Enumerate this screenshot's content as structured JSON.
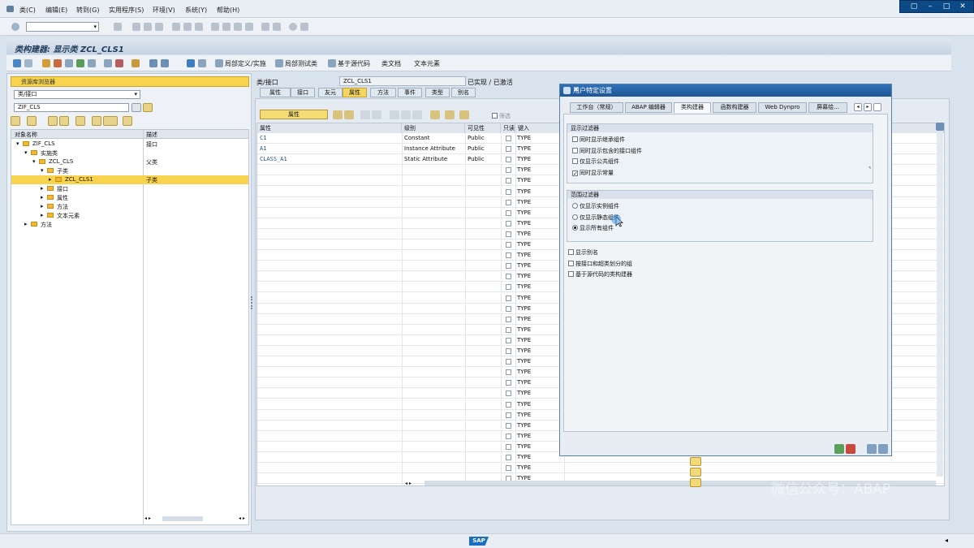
{
  "menu": {
    "items": [
      "类(C)",
      "编辑(E)",
      "转到(G)",
      "实用程序(S)",
      "环境(V)",
      "系统(Y)",
      "帮助(H)"
    ]
  },
  "title": "类构建器: 显示类 ZCL_CLS1",
  "appbar": {
    "buttons": [
      "局部定义/实施",
      "局部测试类",
      "基于源代码",
      "类文档",
      "文本元素"
    ]
  },
  "nav": {
    "header": "资源库浏览器",
    "object_type": "类/接口",
    "object_name": "ZIF_CLS",
    "columns": [
      "对象名称",
      "描述"
    ],
    "rows": [
      {
        "indent": 0,
        "exp": "▾",
        "name": "ZIF_CLS",
        "desc": "接口",
        "selected": false
      },
      {
        "indent": 1,
        "exp": "▾",
        "name": "实施类",
        "desc": "",
        "selected": false
      },
      {
        "indent": 2,
        "exp": "▾",
        "name": "ZCL_CLS",
        "desc": "父类",
        "selected": false
      },
      {
        "indent": 3,
        "exp": "▾",
        "name": "子类",
        "desc": "",
        "selected": false
      },
      {
        "indent": 4,
        "exp": "▸",
        "name": "ZCL_CLS1",
        "desc": "子类",
        "selected": true
      },
      {
        "indent": 3,
        "exp": "▸",
        "name": "接口",
        "desc": "",
        "selected": false
      },
      {
        "indent": 3,
        "exp": "▸",
        "name": "属性",
        "desc": "",
        "selected": false
      },
      {
        "indent": 3,
        "exp": "▸",
        "name": "方法",
        "desc": "",
        "selected": false
      },
      {
        "indent": 3,
        "exp": "▸",
        "name": "文本元素",
        "desc": "",
        "selected": false
      },
      {
        "indent": 1,
        "exp": "▸",
        "name": "方法",
        "desc": "",
        "selected": false
      }
    ]
  },
  "classinfo": {
    "label": "类/接口",
    "name": "ZCL_CLS1",
    "status": "已实现 / 已激活"
  },
  "tabs": [
    "属性",
    "接口",
    "友元",
    "属性",
    "方法",
    "事件",
    "类型",
    "别名"
  ],
  "subbar": {
    "attr_btn": "属性",
    "filter": "筛选"
  },
  "grid": {
    "columns": [
      "属性",
      "级别",
      "可见性",
      "只读",
      "键入"
    ],
    "rows": [
      {
        "attr": "C1",
        "level": "Constant",
        "vis": "Public",
        "type": "TYPE"
      },
      {
        "attr": "A1",
        "level": "Instance Attribute",
        "vis": "Public",
        "type": "TYPE"
      },
      {
        "attr": "CLASS_A1",
        "level": "Static Attribute",
        "vis": "Public",
        "type": "TYPE"
      }
    ],
    "empty_type": "TYPE"
  },
  "dialog": {
    "title": "用户特定设置",
    "tabs": [
      "工作台（常规）",
      "ABAP 编辑器",
      "类构建器",
      "函数构建器",
      "Web Dynpro",
      "屏幕绘..."
    ],
    "display_filter": {
      "title": "显示过滤器",
      "options": [
        {
          "label": "同时显示继承组件",
          "checked": false
        },
        {
          "label": "同时显示包含的接口组件",
          "checked": false
        },
        {
          "label": "仅显示公共组件",
          "checked": false
        },
        {
          "label": "同时显示常量",
          "checked": true
        }
      ]
    },
    "scope_filter": {
      "title": "范围过滤器",
      "options": [
        {
          "label": "仅显示实例组件",
          "checked": false
        },
        {
          "label": "仅显示静态组件",
          "checked": false
        },
        {
          "label": "显示所有组件",
          "checked": true
        }
      ]
    },
    "extra": [
      {
        "label": "显示别名",
        "checked": false
      },
      {
        "label": "按接口和超类划分的组",
        "checked": false
      },
      {
        "label": "基于源代码的类构建器",
        "checked": false
      }
    ]
  },
  "status": {
    "sap": "SAP"
  },
  "watermark": "微信公众号：ABAP"
}
